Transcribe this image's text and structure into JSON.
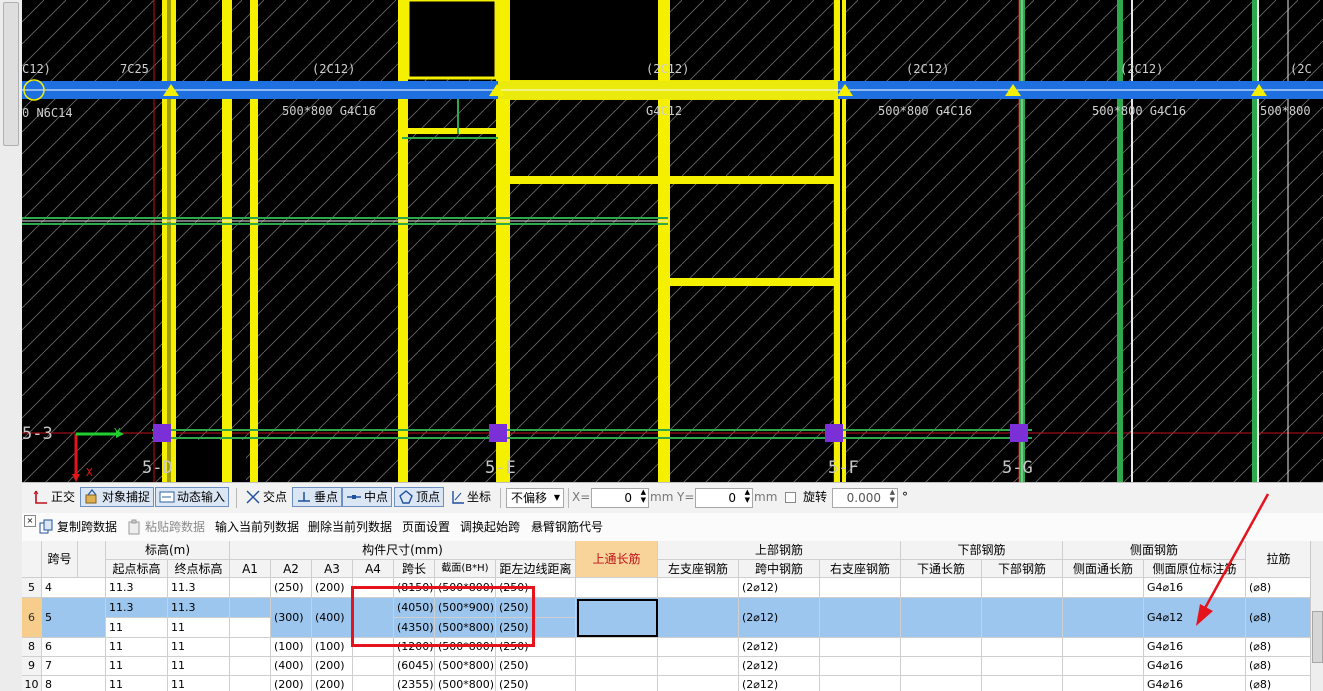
{
  "cad": {
    "beam_labels_top": [
      "C12)",
      "7C25",
      "(2C12)",
      "(2C12)",
      "(2C12)",
      "(2C12)",
      "(2C"
    ],
    "beam_labels_bottom": [
      "0 N6C14",
      "500*800 G4C16",
      "G4C12",
      "500*800 G4C16",
      "500*800 G4C16",
      "500*800"
    ],
    "axis_labels": [
      "5-3",
      "5-D",
      "5-E",
      "5-F",
      "5-G"
    ],
    "ucs": {
      "x_label": "X",
      "y_label": "Y"
    }
  },
  "snapbar": {
    "items": [
      {
        "label": "正交",
        "icon": "ortho-icon",
        "on": false
      },
      {
        "label": "对象捕捉",
        "icon": "object-snap-icon",
        "on": true
      },
      {
        "label": "动态输入",
        "icon": "dynamic-input-icon",
        "on": true
      },
      {
        "label": "交点",
        "icon": "intersection-icon",
        "on": false
      },
      {
        "label": "垂点",
        "icon": "perpendicular-icon",
        "on": true
      },
      {
        "label": "中点",
        "icon": "midpoint-icon",
        "on": true
      },
      {
        "label": "顶点",
        "icon": "vertex-icon",
        "on": true
      },
      {
        "label": "坐标",
        "icon": "coordinate-icon",
        "on": false
      }
    ],
    "offset_value": "不偏移",
    "x_label": "X=",
    "x_value": "0",
    "x_unit": "mm",
    "y_label": "Y=",
    "y_value": "0",
    "y_unit": "mm",
    "rotate_label": "旋转",
    "rotate_value": "0.000",
    "deg": "°"
  },
  "tablebar": {
    "items": [
      {
        "label": "复制跨数据",
        "enabled": true
      },
      {
        "label": "粘贴跨数据",
        "enabled": false
      },
      {
        "label": "输入当前列数据",
        "enabled": true
      },
      {
        "label": "删除当前列数据",
        "enabled": true
      },
      {
        "label": "页面设置",
        "enabled": true
      },
      {
        "label": "调换起始跨",
        "enabled": true
      },
      {
        "label": "悬臂钢筋代号",
        "enabled": true
      }
    ]
  },
  "grid": {
    "group_headers": {
      "span_no": "跨号",
      "elevation": "标高(m)",
      "size": "构件尺寸(mm)",
      "top_through": "上通长筋",
      "top_rebar": "上部钢筋",
      "bottom_rebar": "下部钢筋",
      "side_rebar": "侧面钢筋",
      "tie": "拉筋"
    },
    "sub_headers": {
      "start_elev": "起点标高",
      "end_elev": "终点标高",
      "a1": "A1",
      "a2": "A2",
      "a3": "A3",
      "a4": "A4",
      "span_len": "跨长",
      "section": "截面(B*H)",
      "edge_dist": "距左边线距离",
      "left_support": "左支座钢筋",
      "mid_span": "跨中钢筋",
      "right_support": "右支座钢筋",
      "bottom_through": "下通长筋",
      "bottom": "下部钢筋",
      "side_through": "侧面通长筋",
      "side_marked": "侧面原位标注筋"
    },
    "rows": [
      {
        "rn": "5",
        "span": "4",
        "start": "11.3",
        "end": "11.3",
        "a2": "(250)",
        "a3": "(200)",
        "len": "(8150)",
        "sec": "(500*800)",
        "edge": "(250)",
        "mid": "(2⌀12)",
        "side": "G4⌀16",
        "tie": "(⌀8)"
      },
      {
        "rn": "6",
        "span": "5",
        "start": "11.3",
        "end": "11.3",
        "start2": "11",
        "end2": "11",
        "a2": "(300)",
        "a3": "(400)",
        "len": "(4050)",
        "sec": "(500*900)",
        "edge": "(250)",
        "len2": "(4350)",
        "sec2": "(500*800)",
        "edge2": "(250)",
        "mid": "(2⌀12)",
        "side": "G4⌀12",
        "tie": "(⌀8)"
      },
      {
        "rn": "8",
        "span": "6",
        "start": "11",
        "end": "11",
        "a2": "(100)",
        "a3": "(100)",
        "len": "(1200)",
        "sec": "(500*800)",
        "edge": "(250)",
        "mid": "(2⌀12)",
        "side": "G4⌀16",
        "tie": "(⌀8)"
      },
      {
        "rn": "9",
        "span": "7",
        "start": "11",
        "end": "11",
        "a2": "(400)",
        "a3": "(200)",
        "len": "(6045)",
        "sec": "(500*800)",
        "edge": "(250)",
        "mid": "(2⌀12)",
        "side": "G4⌀16",
        "tie": "(⌀8)"
      },
      {
        "rn": "10",
        "span": "8",
        "start": "11",
        "end": "11",
        "a2": "(200)",
        "a3": "(200)",
        "len": "(2355)",
        "sec": "(500*800)",
        "edge": "(250)",
        "mid": "(2⌀12)",
        "side": "G4⌀16",
        "tie": "(⌀8)"
      }
    ]
  },
  "colors": {
    "cad_background": "#000000",
    "beam_blue": "#1e6fe0",
    "wall_yellow": "#f5f000",
    "annotation_red": "#e5131b",
    "selected_row": "#9dc6ef"
  }
}
